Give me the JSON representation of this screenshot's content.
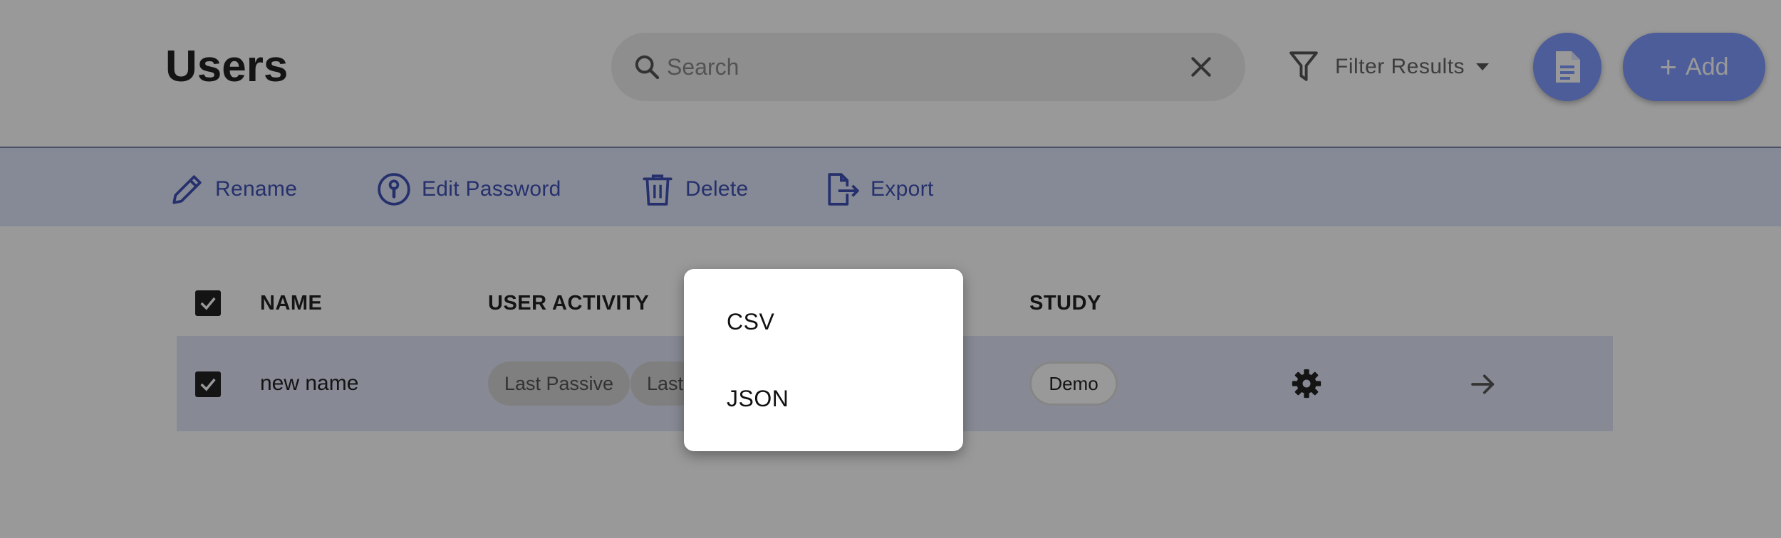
{
  "header": {
    "title": "Users",
    "search": {
      "placeholder": "Search",
      "value": ""
    },
    "filter_label": "Filter Results",
    "add_label": "Add"
  },
  "toolbar": {
    "rename": "Rename",
    "edit_password": "Edit Password",
    "delete": "Delete",
    "export": "Export"
  },
  "table": {
    "columns": [
      "NAME",
      "USER ACTIVITY",
      "STUDY"
    ],
    "rows": [
      {
        "name": "new name",
        "activity": [
          "Last Passive",
          "Last"
        ],
        "study": "Demo"
      }
    ]
  },
  "export_menu": {
    "items": [
      "CSV",
      "JSON"
    ]
  },
  "icons": {
    "search": "search-icon",
    "clear": "close-icon",
    "filter": "filter-icon",
    "caret": "caret-down-icon",
    "document": "document-icon",
    "rename": "pencil-icon",
    "password": "keyhole-icon",
    "delete": "trash-icon",
    "export": "export-file-icon",
    "settings": "gear-icon",
    "open": "arrow-right-icon",
    "checkbox": "checkbox-checked-icon"
  },
  "colors": {
    "accent": "#7f9cff",
    "toolbar_bg": "#dfe6fb",
    "toolbar_text": "#3f51b5",
    "selected_row_bg": "#e2e7f8"
  }
}
